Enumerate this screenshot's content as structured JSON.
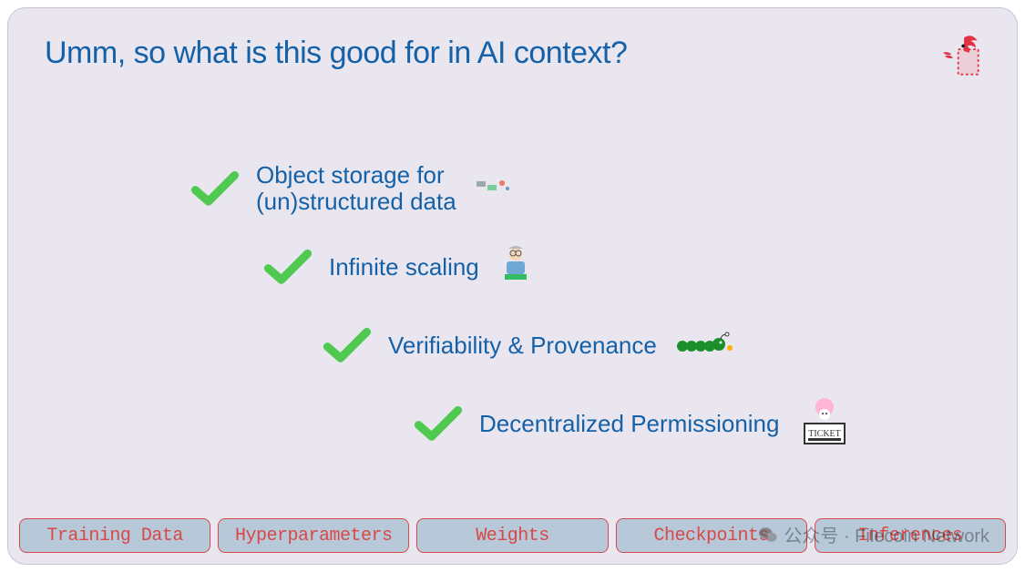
{
  "title": "Umm, so what is this good for in AI context?",
  "features": [
    {
      "label": "Object storage for\n(un)structured data"
    },
    {
      "label": "Infinite scaling"
    },
    {
      "label": "Verifiability & Provenance"
    },
    {
      "label": "Decentralized Permissioning"
    }
  ],
  "tabs": [
    {
      "label": "Training Data"
    },
    {
      "label": "Hyperparameters"
    },
    {
      "label": "Weights"
    },
    {
      "label": "Checkpoints"
    },
    {
      "label": "Inferences"
    }
  ],
  "watermark": "公众号 · Filecoin Network",
  "colors": {
    "bg": "#e9e6f0",
    "headline": "#1461a8",
    "accent_green": "#4fc94f",
    "tab_bg": "#b7c9d8",
    "tab_border": "#d84848"
  }
}
